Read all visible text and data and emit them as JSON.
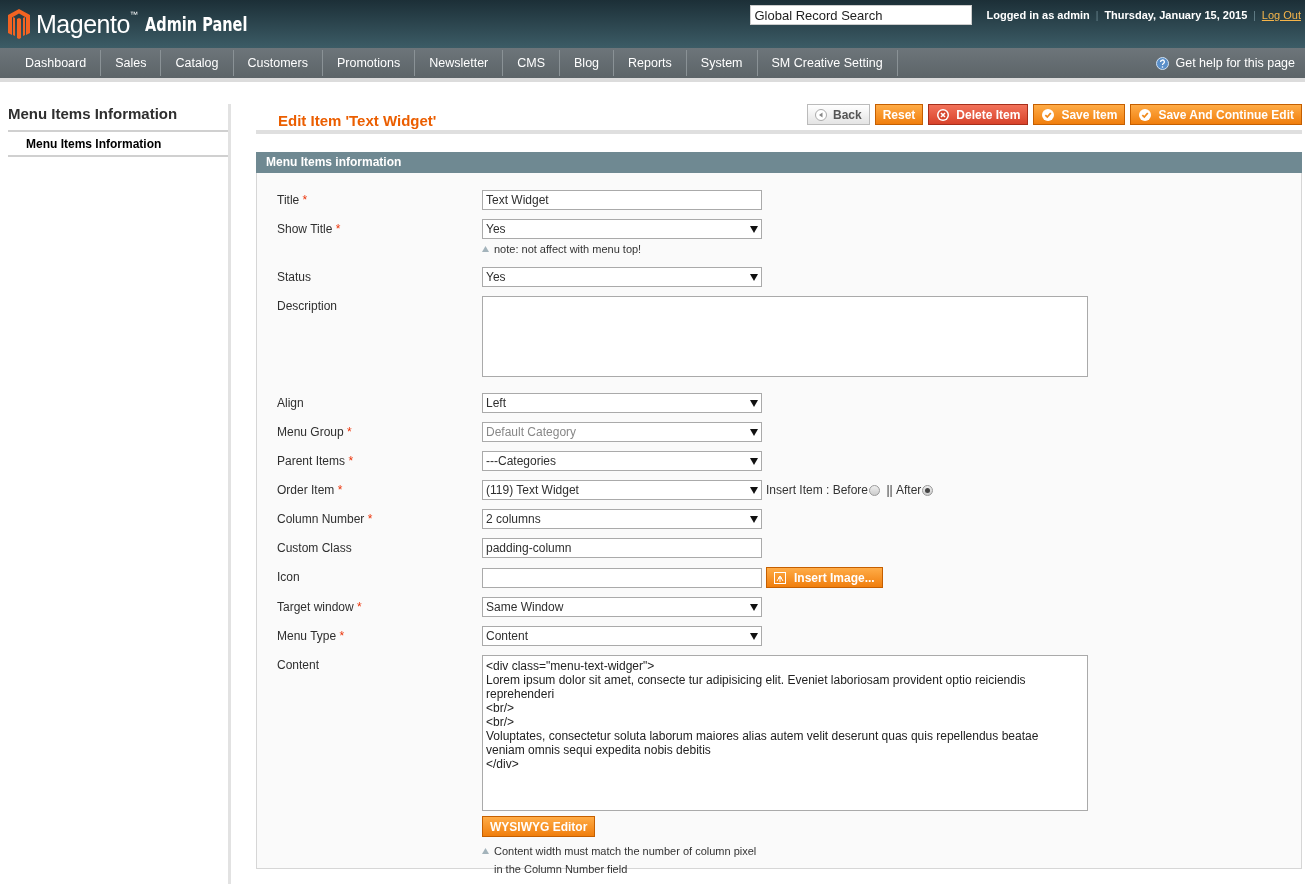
{
  "header": {
    "logo": "Magento",
    "logo_mark": "™",
    "subtitle": "Admin Panel",
    "search": {
      "placeholder": "Global Record Search"
    },
    "user": "Logged in as admin",
    "separator": "|",
    "date": "Thursday, January 15, 2015",
    "logout": "Log Out"
  },
  "nav": {
    "items": [
      "Dashboard",
      "Sales",
      "Catalog",
      "Customers",
      "Promotions",
      "Newsletter",
      "CMS",
      "Blog",
      "Reports",
      "System",
      "SM Creative Setting"
    ],
    "help": "Get help for this page"
  },
  "sidebar": {
    "title": "Menu Items Information",
    "tabs": [
      {
        "label": "Menu Items Information",
        "selected": true
      }
    ]
  },
  "page": {
    "title": "Edit Item 'Text Widget'",
    "buttons": [
      {
        "kind": "back",
        "label": "Back"
      },
      {
        "kind": "reset",
        "label": "Reset"
      },
      {
        "kind": "delete",
        "label": "Delete Item"
      },
      {
        "kind": "save",
        "label": "Save Item"
      },
      {
        "kind": "save",
        "label": "Save And Continue Edit"
      }
    ]
  },
  "form": {
    "title": "Menu Items information",
    "fields": [
      {
        "kind": "text",
        "label": "Title",
        "required_mark": "*",
        "value": "Text Widget"
      },
      {
        "kind": "select",
        "label": "Show Title",
        "required_mark": "*",
        "value": "Yes",
        "note": "note: not affect with menu top!"
      },
      {
        "kind": "select",
        "label": "Status",
        "value": "Yes"
      },
      {
        "kind": "textarea",
        "label": "Description"
      },
      {
        "kind": "select",
        "label": "Align",
        "value": "Left"
      },
      {
        "kind": "select",
        "label": "Menu Group",
        "required_mark": "*",
        "value": "Default Category",
        "disabled": true
      },
      {
        "kind": "select",
        "label": "Parent Items",
        "required_mark": "*",
        "value": "---Categories"
      },
      {
        "kind": "select",
        "label": "Order Item",
        "required_mark": "*",
        "value": "(119) Text Widget",
        "insert": {
          "label": "Insert Item :",
          "separator": "||",
          "options": [
            {
              "label": "Before",
              "selected": false
            },
            {
              "label": "After",
              "selected": true
            }
          ]
        }
      },
      {
        "kind": "select",
        "label": "Column Number",
        "required_mark": "*",
        "value": "2 columns"
      },
      {
        "kind": "text",
        "label": "Custom Class",
        "value": "padding-column"
      },
      {
        "kind": "image",
        "label": "Icon",
        "button": "Insert Image..."
      },
      {
        "kind": "select",
        "label": "Target window",
        "required_mark": "*",
        "value": "Same Window"
      },
      {
        "kind": "select",
        "label": "Menu Type",
        "required_mark": "*",
        "value": "Content"
      },
      {
        "kind": "editor",
        "label": "Content",
        "value": "<div class=\"menu-text-widger\">\nLorem ipsum dolor sit amet, consecte tur adipisicing elit. Eveniet laboriosam provident optio reiciendis reprehenderi\n<br/>\n<br/>\nVoluptates, consectetur soluta laborum maiores alias autem velit deserunt quas quis repellendus beatae veniam omnis sequi expedita nobis debitis\n</div>",
        "button": "WYSIWYG Editor",
        "note": "Content width must match the number of column pixel in the Column Number field"
      }
    ]
  }
}
